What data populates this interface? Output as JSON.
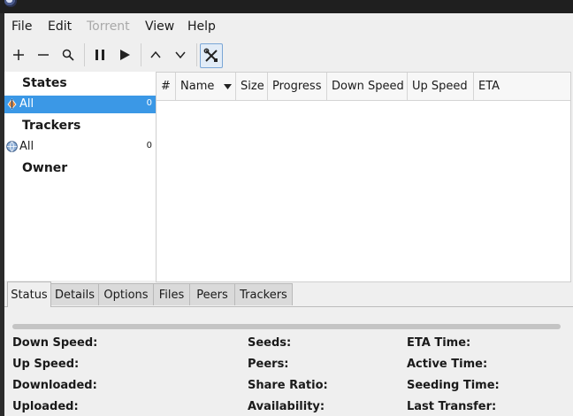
{
  "menu": [
    "File",
    "Edit",
    "Torrent",
    "View",
    "Help"
  ],
  "toolbar": {
    "icons": [
      "add-icon",
      "remove-icon",
      "search-icon",
      "pause-icon",
      "play-icon",
      "move-up-icon",
      "move-down-icon",
      "preferences-icon"
    ]
  },
  "sidebar": {
    "states_header": "States",
    "states_all_label": "All",
    "states_all_count": "0",
    "trackers_header": "Trackers",
    "trackers_all_label": "All",
    "trackers_all_count": "0",
    "owner_header": "Owner"
  },
  "table": {
    "columns": [
      "#",
      "Name",
      "Size",
      "Progress",
      "Down Speed",
      "Up Speed",
      "ETA"
    ],
    "sort_icon": "sort-descending-icon"
  },
  "tabs": [
    "Status",
    "Details",
    "Options",
    "Files",
    "Peers",
    "Trackers"
  ],
  "status_progress": 0,
  "info": {
    "col1": [
      "Down Speed:",
      "Up Speed:",
      "Downloaded:",
      "Uploaded:"
    ],
    "col2": [
      "Seeds:",
      "Peers:",
      "Share Ratio:",
      "Availability:"
    ],
    "col3": [
      "ETA Time:",
      "Active Time:",
      "Seeding Time:",
      "Last Transfer:"
    ]
  },
  "colors": {
    "selection": "#3b98e6",
    "window_bg": "#efefef",
    "titlebar": "#1f1f1f"
  }
}
